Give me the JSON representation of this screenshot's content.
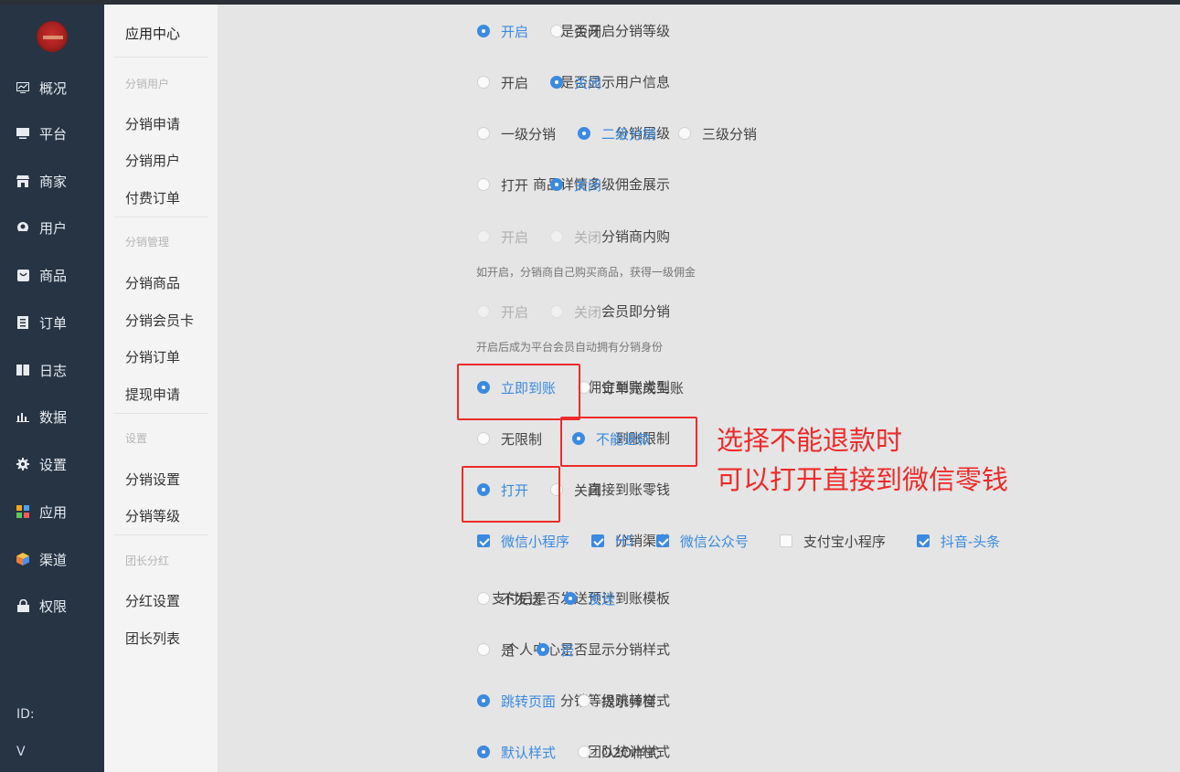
{
  "nav": {
    "items": [
      {
        "label": "概况",
        "icon": "chart-icon"
      },
      {
        "label": "平台",
        "icon": "monitor-icon"
      },
      {
        "label": "商家",
        "icon": "store-icon"
      },
      {
        "label": "用户",
        "icon": "user-icon"
      },
      {
        "label": "商品",
        "icon": "bag-icon"
      },
      {
        "label": "订单",
        "icon": "list-icon"
      },
      {
        "label": "日志",
        "icon": "book-icon"
      },
      {
        "label": "数据",
        "icon": "bar-chart-icon"
      },
      {
        "label": "设置",
        "icon": "gear-icon"
      },
      {
        "label": "应用",
        "icon": "grid-icon"
      },
      {
        "label": "渠道",
        "icon": "cube-icon"
      },
      {
        "label": "权限",
        "icon": "lock-icon"
      }
    ],
    "footer_id": "ID:",
    "footer_v": "V"
  },
  "subnav": {
    "title": "应用中心",
    "group1": "分销用户",
    "g1_items": [
      "分销申请",
      "分销用户",
      "付费订单"
    ],
    "group2": "分销管理",
    "g2_items": [
      "分销商品",
      "分销会员卡",
      "分销订单",
      "提现申请"
    ],
    "group3": "设置",
    "g3_items": [
      "分销设置",
      "分销等级"
    ],
    "group4": "团长分红",
    "g4_items": [
      "分红设置",
      "团长列表"
    ]
  },
  "settings": {
    "r1": {
      "label": "是否开启分销等级",
      "opts": [
        "开启",
        "关闭"
      ]
    },
    "r2": {
      "label": "是否显示用户信息",
      "opts": [
        "开启",
        "关闭"
      ]
    },
    "r3": {
      "label": "分销层级",
      "opts": [
        "一级分销",
        "二级分销",
        "三级分销"
      ]
    },
    "r4": {
      "label": "商品详情多级佣金展示",
      "opts": [
        "打开",
        "关闭"
      ]
    },
    "r5": {
      "label": "分销商内购",
      "opts": [
        "开启",
        "关闭"
      ],
      "hint": "如开启，分销商自己购买商品，获得一级佣金"
    },
    "r6": {
      "label": "会员即分销",
      "opts": [
        "开启",
        "关闭"
      ],
      "hint": "开启后成为平台会员自动拥有分销身份"
    },
    "r7": {
      "label": "佣金到账类型",
      "opts": [
        "立即到账",
        "订单完成到账"
      ]
    },
    "r8": {
      "label": "到账限制",
      "opts": [
        "无限制",
        "不能退款"
      ]
    },
    "r9": {
      "label": "直接到账零钱",
      "opts": [
        "打开",
        "关闭"
      ]
    },
    "r10": {
      "label": "分销渠道",
      "opts": [
        "微信小程序",
        "H5",
        "微信公众号",
        "支付宝小程序",
        "抖音-头条"
      ]
    },
    "r11": {
      "label": "支付后是否发送预计到账模板",
      "opts": [
        "不发送",
        "发送"
      ]
    },
    "r12": {
      "label": "个人中心是否显示分销样式",
      "opts": [
        "是",
        "否"
      ]
    },
    "r13": {
      "label": "分销等级跳转样式",
      "opts": [
        "跳转页面",
        "提示弹窗"
      ]
    },
    "r14": {
      "label": "团队统计样式",
      "opts": [
        "默认样式",
        "O2O样式"
      ]
    }
  },
  "annotation": {
    "line1": "选择不能退款时",
    "line2": "可以打开直接到微信零钱",
    "color": "#ee2a2a"
  },
  "colors": {
    "accent": "#3b8ae0",
    "nav_bg": "#263444"
  }
}
